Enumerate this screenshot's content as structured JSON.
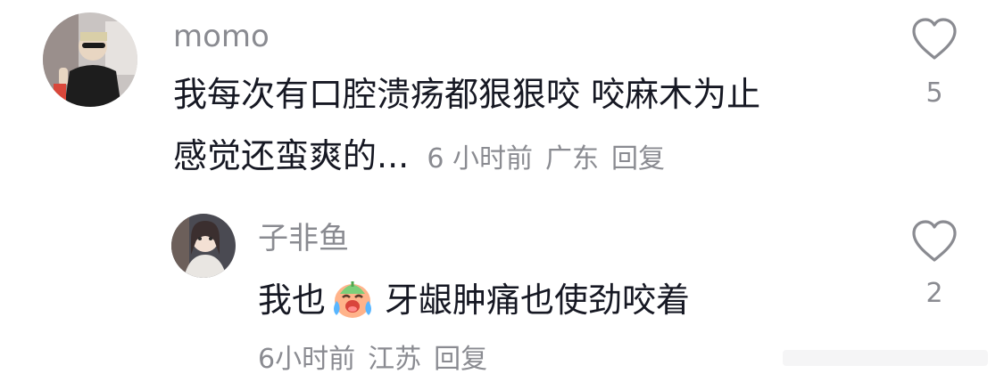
{
  "comments": [
    {
      "username": "momo",
      "text_line1": "我每次有口腔溃疡都狠狠咬 咬麻木为止",
      "text_line2": "感觉还蛮爽的...",
      "time": "6 小时前",
      "location": "广东",
      "reply_label": "回复",
      "likes": "5"
    },
    {
      "username": "子非鱼",
      "text_before_emoji": "我也",
      "emoji": "crying-laughing-face-emoji",
      "text_after_emoji": "牙龈肿痛也使劲咬着",
      "time": "6小时前",
      "location": "江苏",
      "reply_label": "回复",
      "likes": "2"
    }
  ],
  "colors": {
    "primary_text": "#161823",
    "secondary_text": "#8a8b91",
    "background": "#ffffff"
  },
  "icons": [
    "heart-outline-icon"
  ]
}
